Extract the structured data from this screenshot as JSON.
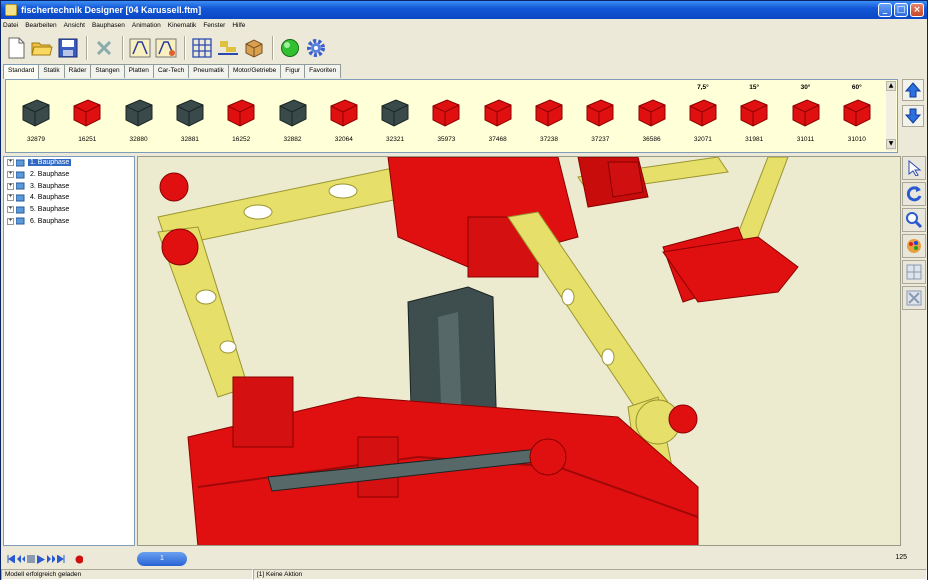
{
  "window": {
    "title": "fischertechnik Designer [04 Karussell.ftm]"
  },
  "menu": [
    "Datei",
    "Bearbeiten",
    "Ansicht",
    "Bauphasen",
    "Animation",
    "Kinematik",
    "Fenster",
    "Hilfe"
  ],
  "toolbar": {
    "icons": [
      "new-file-icon",
      "open-folder-icon",
      "save-icon",
      "delete-icon",
      "build-phase-icon",
      "build-phase-edit-icon",
      "grid-icon",
      "align-icon",
      "box-icon",
      "green-ball-icon",
      "gear-icon"
    ]
  },
  "tabs": [
    "Standard",
    "Statik",
    "Räder",
    "Stangen",
    "Platten",
    "Car-Tech",
    "Pneumatik",
    "Motor/Getriebe",
    "Figur",
    "Favoriten"
  ],
  "active_tab": "Standard",
  "palette": {
    "parts": [
      {
        "num": "32879",
        "angle": ""
      },
      {
        "num": "16251",
        "angle": ""
      },
      {
        "num": "32880",
        "angle": ""
      },
      {
        "num": "32881",
        "angle": ""
      },
      {
        "num": "16252",
        "angle": ""
      },
      {
        "num": "32882",
        "angle": ""
      },
      {
        "num": "32064",
        "angle": ""
      },
      {
        "num": "32321",
        "angle": ""
      },
      {
        "num": "35973",
        "angle": ""
      },
      {
        "num": "37468",
        "angle": ""
      },
      {
        "num": "37238",
        "angle": ""
      },
      {
        "num": "37237",
        "angle": ""
      },
      {
        "num": "36586",
        "angle": ""
      },
      {
        "num": "32071",
        "angle": "7,5°"
      },
      {
        "num": "31981",
        "angle": "15°"
      },
      {
        "num": "31011",
        "angle": "30°"
      },
      {
        "num": "31010",
        "angle": "60°"
      }
    ]
  },
  "tree": {
    "items": [
      "1. Bauphase",
      "2. Bauphase",
      "3. Bauphase",
      "4. Bauphase",
      "5. Bauphase",
      "6. Bauphase"
    ],
    "selected": "1. Bauphase",
    "expander": "+"
  },
  "animation": {
    "phase": "1",
    "frames": "125"
  },
  "status": {
    "left": "Modell erfolgreich geladen",
    "right": "[1] Keine Aktion"
  },
  "colors": {
    "red": "#e01010",
    "yellow": "#e8e070",
    "dark": "#3a4a4a",
    "viewport_bg": "#ecebd0"
  }
}
